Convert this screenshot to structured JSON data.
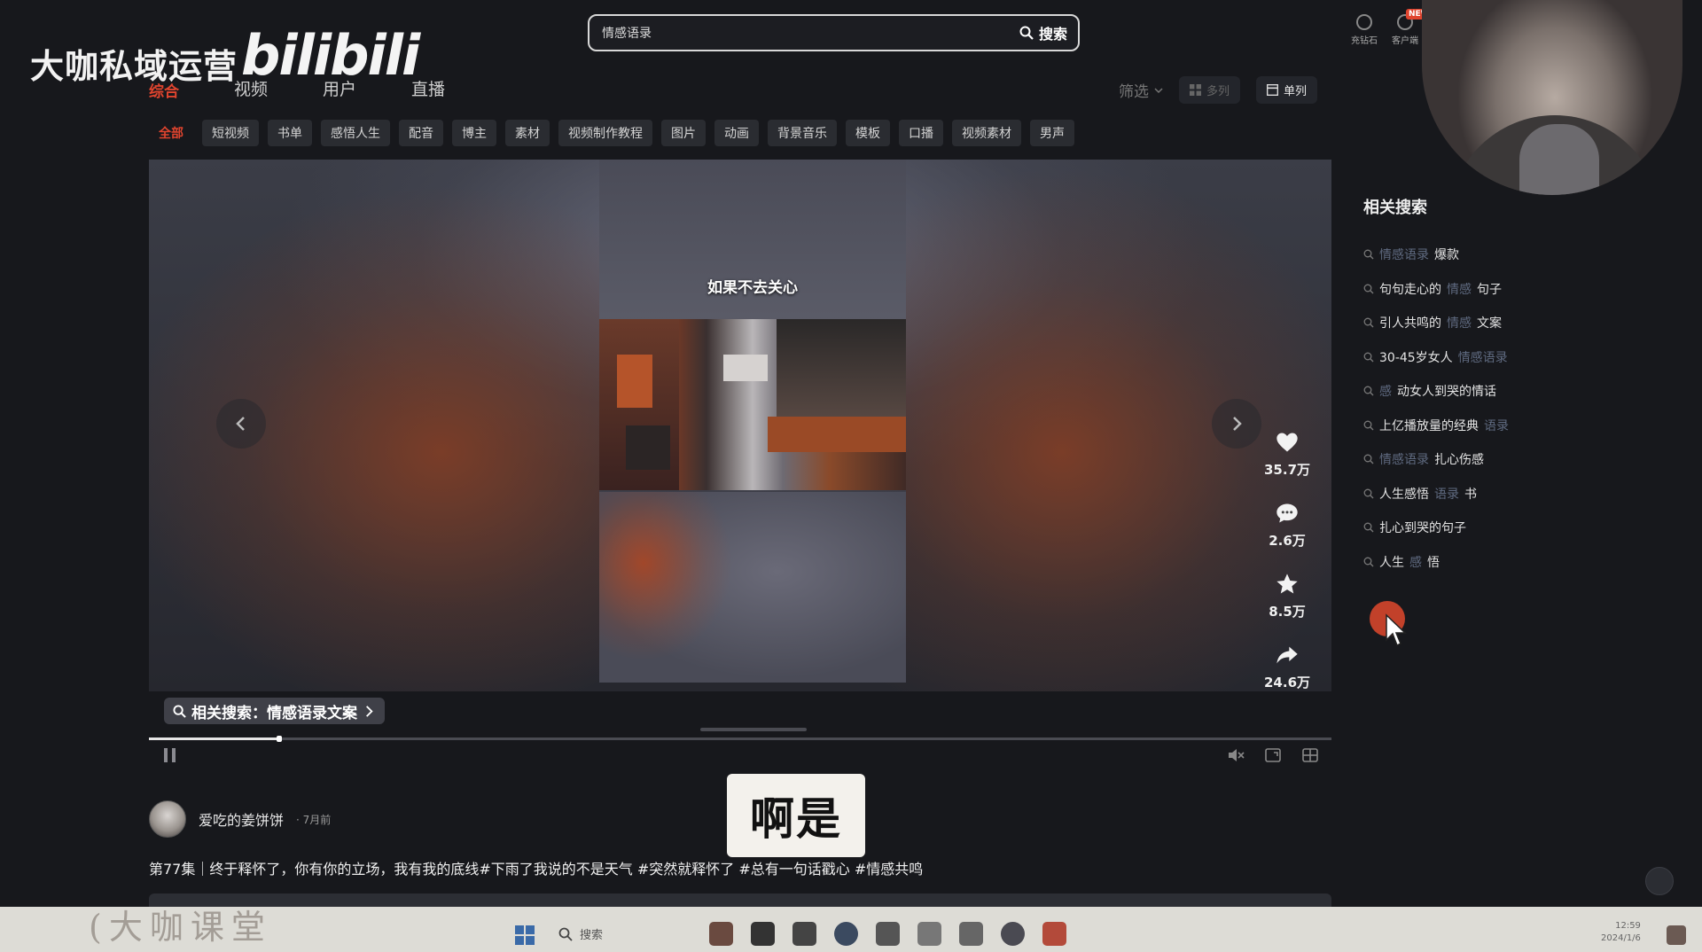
{
  "watermark": {
    "brand": "大咖私域运营",
    "logo": "bilibili",
    "course": "(大咖课堂"
  },
  "search": {
    "value": "情感语录",
    "button": "搜索"
  },
  "tabs": [
    "综合",
    "视频",
    "用户",
    "直播"
  ],
  "view": {
    "filter": "筛选",
    "multi": "多列",
    "single": "单列"
  },
  "top_icons": [
    "充钻石",
    "客户端"
  ],
  "top_badge": "NEW",
  "chips": [
    "全部",
    "短视频",
    "书单",
    "感悟人生",
    "配音",
    "博主",
    "素材",
    "视频制作教程",
    "图片",
    "动画",
    "背景音乐",
    "模板",
    "口播",
    "视频素材",
    "男声"
  ],
  "player": {
    "caption": "如果不去关心",
    "related_label": "相关搜索：情感语录文案",
    "progress": 0.11,
    "actions": [
      {
        "icon": "heart-icon",
        "count": "35.7万"
      },
      {
        "icon": "comment-icon",
        "count": "2.6万"
      },
      {
        "icon": "star-icon",
        "count": "8.5万"
      },
      {
        "icon": "share-icon",
        "count": "24.6万"
      }
    ],
    "more": "..."
  },
  "author": {
    "name": "爱吃的姜饼饼",
    "time": "· 7月前"
  },
  "description": "第77集｜终于释怀了，你有你的立场，我有我的底线#下雨了我说的不是天气 #突然就释怀了 #总有一句话戳心 #情感共鸣",
  "subtitle": "啊是",
  "sidebar": {
    "title": "相关搜索",
    "items": [
      {
        "hl": "情感语录",
        "rest": "爆款"
      },
      {
        "pre": "句句走心的",
        "hl": "情感",
        "rest": "句子"
      },
      {
        "pre": "引人共鸣的",
        "hl": "情感",
        "rest": "文案"
      },
      {
        "pre": "30-45岁女人",
        "hl": "情感语录",
        "rest": ""
      },
      {
        "hl": "感",
        "rest": "动女人到哭的情话"
      },
      {
        "pre": "上亿播放量的经典",
        "hl": "语录",
        "rest": ""
      },
      {
        "hl": "情感语录",
        "rest": "扎心伤感"
      },
      {
        "pre": "人生感悟",
        "hl": "语录",
        "rest": "书"
      },
      {
        "pre": "扎心到哭的句子",
        "hl": "",
        "rest": ""
      },
      {
        "pre": "人生",
        "hl": "感",
        "rest": "悟"
      }
    ]
  },
  "taskbar": {
    "search": "搜索",
    "time": "12:59",
    "date": "2024/1/6"
  },
  "colors": {
    "accent": "#e0442e",
    "background": "#17181c",
    "highlight": "#5f6a80"
  }
}
